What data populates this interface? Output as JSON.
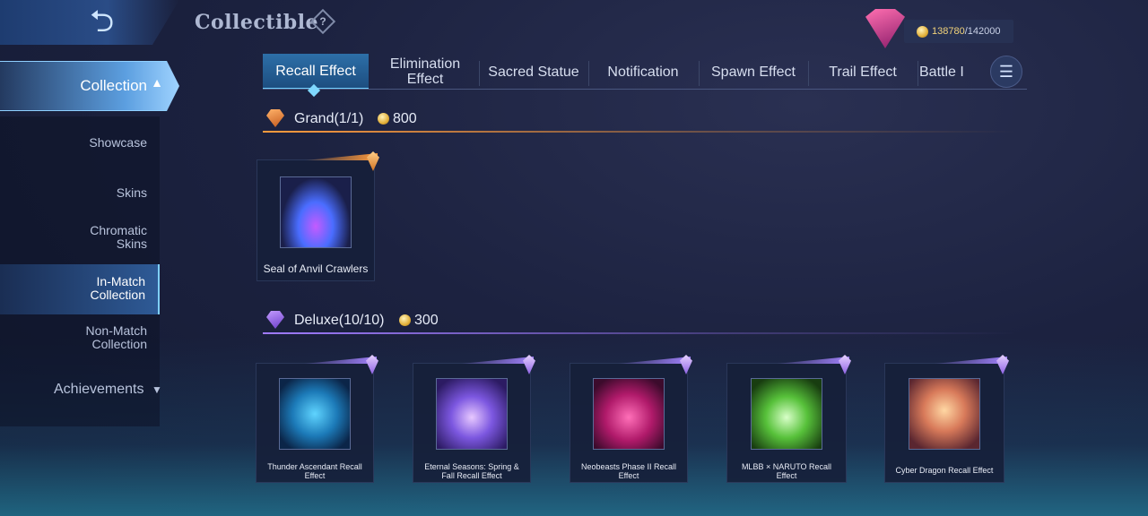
{
  "header": {
    "back_icon": "back-arrow-icon",
    "title": "Collectible",
    "help_icon": "question-mark-icon",
    "rank_icon": "rank-emblem-icon",
    "points_current": "138780",
    "points_max": "/142000"
  },
  "sidebar": {
    "section": "Collection",
    "items": [
      {
        "label": "Showcase"
      },
      {
        "label": "Skins"
      },
      {
        "label": "Chromatic Skins"
      },
      {
        "label": "In-Match Collection"
      },
      {
        "label": "Non-Match Collection"
      }
    ],
    "achievements": "Achievements"
  },
  "tabs": [
    {
      "label": "Recall Effect",
      "active": true
    },
    {
      "label": "Elimination Effect"
    },
    {
      "label": "Sacred Statue"
    },
    {
      "label": "Notification"
    },
    {
      "label": "Spawn Effect"
    },
    {
      "label": "Trail Effect"
    },
    {
      "label": "Battle I"
    }
  ],
  "filter_icon": "filter-icon",
  "grand": {
    "title": "Grand(1/1)",
    "cost": "800",
    "accent": "#ff9b3d",
    "items": [
      {
        "name": "Seal of Anvil Crawlers"
      }
    ]
  },
  "deluxe": {
    "title": "Deluxe(10/10)",
    "cost": "300",
    "accent": "#a07bff",
    "items": [
      {
        "name": "Thunder Ascendant Recall Effect"
      },
      {
        "name": "Eternal Seasons: Spring & Fall Recall Effect"
      },
      {
        "name": "Neobeasts Phase II Recall Effect"
      },
      {
        "name": "MLBB × NARUTO Recall Effect"
      },
      {
        "name": "Cyber Dragon Recall Effect"
      }
    ]
  }
}
